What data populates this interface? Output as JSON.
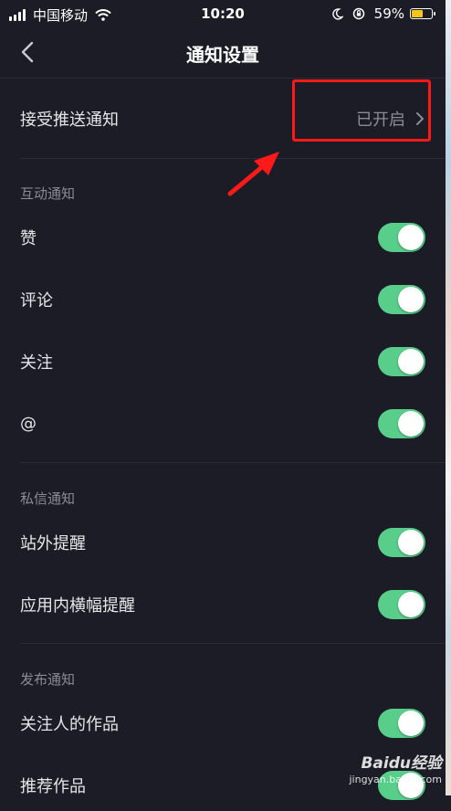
{
  "status_bar": {
    "carrier": "中国移动",
    "time": "10:20",
    "battery_percent": "59%",
    "battery_level": 0.59,
    "icons": [
      "signal-icon",
      "wifi-icon",
      "moon-icon",
      "rotation-lock-icon",
      "battery-icon"
    ]
  },
  "nav": {
    "title": "通知设置",
    "back_icon": "chevron-left-icon"
  },
  "push": {
    "label": "接受推送通知",
    "value": "已开启",
    "chevron_icon": "chevron-right-icon"
  },
  "sections": [
    {
      "title": "互动通知",
      "items": [
        {
          "label": "赞",
          "on": true
        },
        {
          "label": "评论",
          "on": true
        },
        {
          "label": "关注",
          "on": true
        },
        {
          "label": "@",
          "on": true
        }
      ]
    },
    {
      "title": "私信通知",
      "items": [
        {
          "label": "站外提醒",
          "on": true
        },
        {
          "label": "应用内横幅提醒",
          "on": true
        }
      ]
    },
    {
      "title": "发布通知",
      "items": [
        {
          "label": "关注人的作品",
          "on": true
        },
        {
          "label": "推荐作品",
          "on": true
        }
      ]
    }
  ],
  "annotation": {
    "highlight_color": "#ff1a1a",
    "arrow_color": "#ff1a1a"
  },
  "colors": {
    "background": "#1b1c25",
    "toggle_on": "#58ce8a",
    "battery_fill": "#f5c518"
  },
  "watermark": {
    "brand": "Baidu经验",
    "domain": "jingyan.baidu.com"
  }
}
